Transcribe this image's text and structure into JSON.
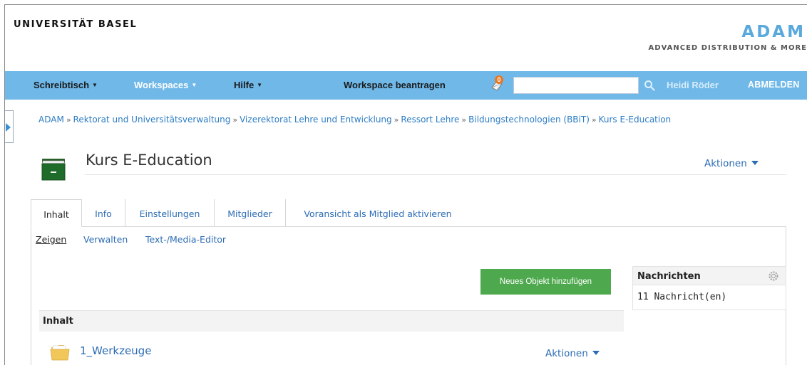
{
  "header": {
    "university": "UNIVERSITÄT BASEL",
    "app_title": "ADAM",
    "app_subtitle": "ADVANCED DISTRIBUTION & MORE"
  },
  "navbar": {
    "items": [
      {
        "label": "Schreibtisch"
      },
      {
        "label": "Workspaces"
      },
      {
        "label": "Hilfe"
      }
    ],
    "request_workspace": "Workspace beantragen",
    "notification_count": "0",
    "search_value": "",
    "user_name": "Heidi Röder",
    "logout": "ABMELDEN"
  },
  "breadcrumb": [
    "ADAM",
    "Rektorat und Universitätsverwaltung",
    "Vizerektorat Lehre und Entwicklung",
    "Ressort Lehre",
    "Bildungstechnologien (BBiT)",
    "Kurs E-Education"
  ],
  "breadcrumb_separator": "»",
  "page": {
    "title": "Kurs E-Education",
    "actions": "Aktionen"
  },
  "tabs": [
    {
      "label": "Inhalt",
      "active": true
    },
    {
      "label": "Info"
    },
    {
      "label": "Einstellungen"
    },
    {
      "label": "Mitglieder"
    },
    {
      "label": "Voransicht als Mitglied aktivieren"
    }
  ],
  "subtabs": [
    {
      "label": "Zeigen",
      "active": true
    },
    {
      "label": "Verwalten"
    },
    {
      "label": "Text-/Media-Editor"
    }
  ],
  "add_object_button": "Neues Objekt hinzufügen",
  "messages": {
    "title": "Nachrichten",
    "body": "11 Nachricht(en)"
  },
  "content": {
    "header": "Inhalt",
    "items": [
      {
        "title": "1_Werkzeuge",
        "actions": "Aktionen"
      }
    ]
  },
  "colors": {
    "navbar": "#6fb8e8",
    "link": "#2c6cb4",
    "button": "#4ea94e",
    "brand": "#5aa9dc"
  }
}
